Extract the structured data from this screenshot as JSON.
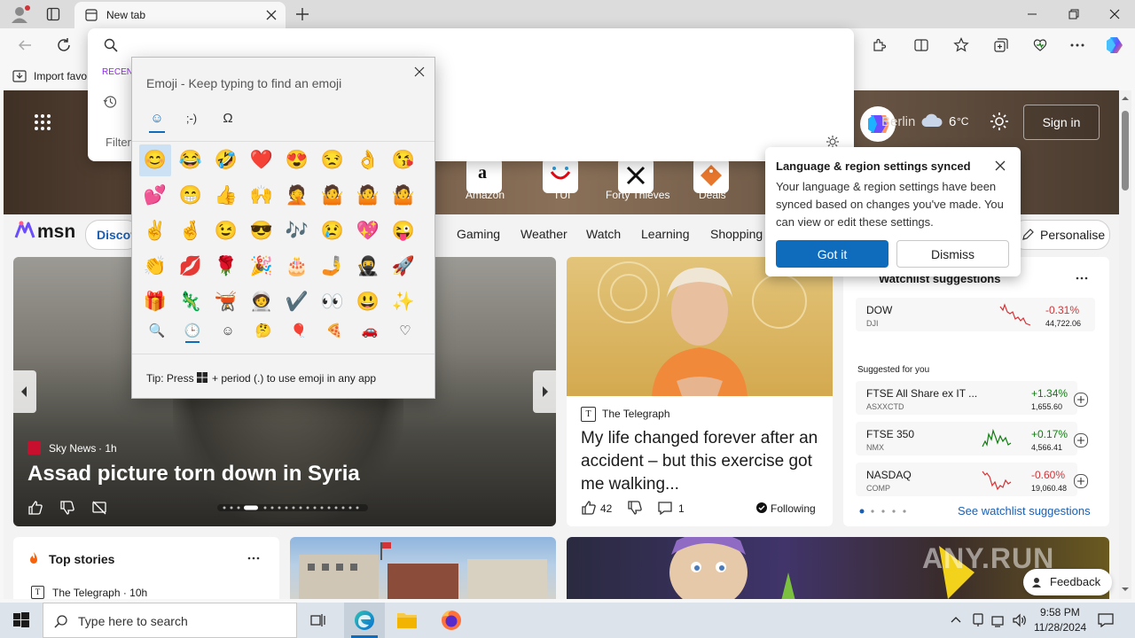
{
  "browser": {
    "tab_title": "New tab",
    "favorites_label": "Import favo",
    "recent_label": "RECEN",
    "filter_label": "Filter"
  },
  "emoji_panel": {
    "header": "Emoji - Keep typing to find an emoji",
    "tab_kaomoji": ";-)",
    "tab_symbols": "Ω",
    "tab_emoji": "☺",
    "emojis": [
      [
        "😊",
        "😂",
        "🤣",
        "❤️",
        "😍",
        "😒",
        "👌",
        "😘"
      ],
      [
        "💕",
        "😁",
        "👍",
        "🙌",
        "🤦",
        "🤷",
        "🤷",
        "🤷"
      ],
      [
        "✌️",
        "🤞",
        "😉",
        "😎",
        "🎶",
        "😢",
        "💖",
        "😜"
      ],
      [
        "👏",
        "💋",
        "🌹",
        "🎉",
        "🎂",
        "🤳",
        "🥷",
        "🚀"
      ],
      [
        "🎁",
        "🦎",
        "🫕",
        "🧑‍🚀",
        "✔️",
        "👀",
        "😃",
        "✨"
      ]
    ],
    "categories": [
      "🔍",
      "🕒",
      "☺",
      "🤔",
      "🎈",
      "🍕",
      "🚗",
      "♡"
    ],
    "tip_prefix": "Tip: Press",
    "tip_suffix": "+ period (.) to use emoji in any app"
  },
  "hero": {
    "location": "Berlin",
    "temperature": "6",
    "temp_unit": "°C",
    "signin": "Sign in",
    "tiles": [
      "Amazon",
      "TUI",
      "Forty Thieves",
      "Deals"
    ]
  },
  "notice": {
    "title": "Language & region settings synced",
    "body": "Your language & region settings have been synced based on changes you've made. You can view or edit these settings.",
    "primary": "Got it",
    "secondary": "Dismiss"
  },
  "msn": {
    "logo": "msn",
    "discover": "Discov",
    "nav": [
      "Gaming",
      "Weather",
      "Watch",
      "Learning",
      "Shopping"
    ],
    "personalise": "Personalise"
  },
  "feature": {
    "source": "Sky News",
    "age": "· 1h",
    "headline": "Assad picture torn down in Syria"
  },
  "article": {
    "source": "The Telegraph",
    "headline": "My life changed forever after an accident – but this exercise got me walking...",
    "likes": "42",
    "comments": "1",
    "following": "Following"
  },
  "watchlist": {
    "title": "Watchlist suggestions",
    "suggested_label": "Suggested for you",
    "see_more": "See watchlist suggestions",
    "top": {
      "name": "DOW",
      "symbol": "DJI",
      "change": "-0.31%",
      "value": "44,722.06",
      "color": "#d13438"
    },
    "items": [
      {
        "name": "FTSE All Share ex IT ...",
        "symbol": "ASXXCTD",
        "change": "+1.34%",
        "value": "1,655.60",
        "color": "#107c10"
      },
      {
        "name": "FTSE 350",
        "symbol": "NMX",
        "change": "+0.17%",
        "value": "4,566.41",
        "color": "#107c10"
      },
      {
        "name": "NASDAQ",
        "symbol": "COMP",
        "change": "-0.60%",
        "value": "19,060.48",
        "color": "#d13438"
      }
    ]
  },
  "top_stories": {
    "title": "Top stories",
    "source": "The Telegraph · 10h"
  },
  "feedback": "Feedback",
  "watermark": "ANY.RUN",
  "taskbar": {
    "search_placeholder": "Type here to search",
    "time": "9:58 PM",
    "date": "11/28/2024"
  },
  "colors": {
    "accent": "#0f6cbd",
    "msn_blue": "#1a5fb4"
  }
}
